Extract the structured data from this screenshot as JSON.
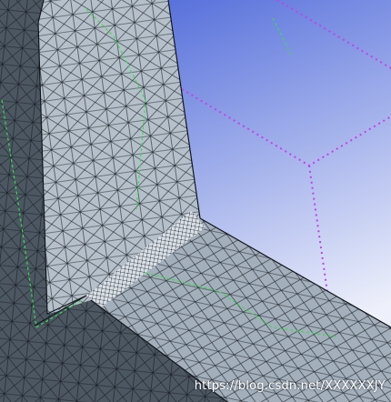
{
  "viewport": {
    "background_top": "#3e5bd6",
    "background_bottom": "#eef1fb",
    "mesh_face_light": "#b9c3cd",
    "mesh_face_mid": "#9aa6b2",
    "mesh_face_dark": "#4a5560",
    "mesh_line": "#1b2128",
    "edge_highlight": "#33e04a",
    "bounding_box": "#c540e8"
  },
  "watermark": {
    "text": "https://blog.csdn.net/XXXXXXJY"
  }
}
